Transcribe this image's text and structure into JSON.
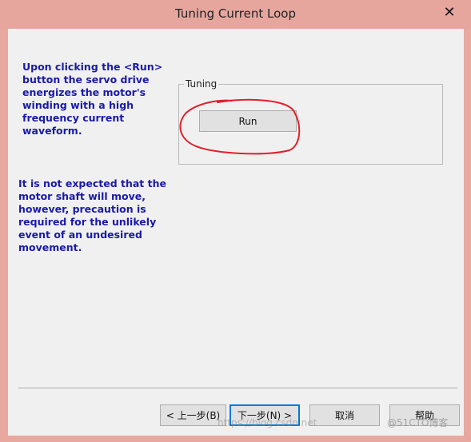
{
  "window": {
    "title": "Tuning Current Loop",
    "close_glyph": "✕"
  },
  "instructions": {
    "paragraph1": "Upon clicking the <Run>\nbutton the servo drive\nenergizes the motor's\nwinding with a high\nfrequency current\nwaveform.",
    "paragraph2": "It is not expected that the\nmotor shaft will move,\nhowever, precaution is\nrequired for the unlikely\nevent of an undesired\nmovement."
  },
  "tuning": {
    "group_label": "Tuning",
    "run_label": "Run"
  },
  "annotation_color": "#e0202a",
  "buttons": {
    "back": "< 上一步(B)",
    "next": "下一步(N) >",
    "cancel": "取消",
    "help": "帮助"
  },
  "watermark": {
    "url": "https://blog.csdn.net",
    "brand": "@51CTO博客"
  }
}
